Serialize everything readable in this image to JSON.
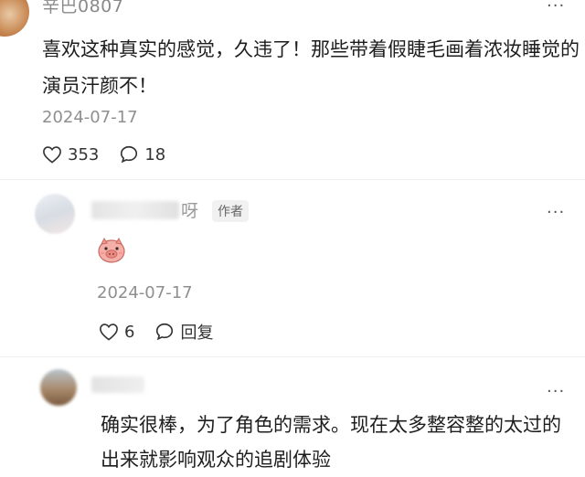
{
  "comments": [
    {
      "username": "辛巴0807",
      "text": "喜欢这种真实的感觉，久违了！那些带着假睫毛画着浓妆睡觉的演员汗颜不！",
      "date": "2024-07-17",
      "likes": "353",
      "replies": "18",
      "more": "···"
    },
    {
      "username_visible": "呀",
      "author_tag": "作者",
      "sticker": "pig-face-emoji",
      "date": "2024-07-17",
      "likes": "6",
      "reply_label": "回复",
      "more": "···"
    },
    {
      "text": "确实很棒，为了角色的需求。现在太多整容整的太过的出来就影响观众的追剧体验",
      "more": "···"
    }
  ],
  "colors": {
    "text": "#1e1e1e",
    "meta": "#8f8f8f",
    "tag_bg": "#f1f1f1"
  }
}
